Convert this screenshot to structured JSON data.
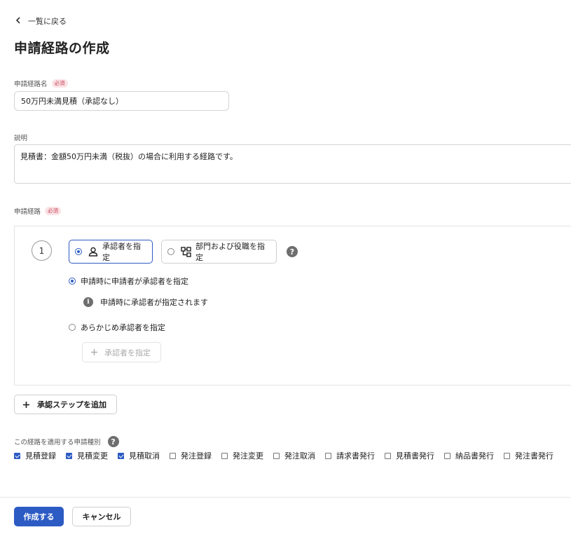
{
  "back_link": {
    "label": "一覧に戻る",
    "icon": "chevron-left-icon"
  },
  "page_title": "申請経路の作成",
  "route_name": {
    "label": "申請経路名",
    "required_badge": "必須",
    "value": "50万円未満見積（承認なし）"
  },
  "description": {
    "label": "説明",
    "value": "見積書：金額50万円未満（税抜）の場合に利用する経路です。"
  },
  "route": {
    "label": "申請経路",
    "required_badge": "必須",
    "steps": [
      {
        "number": "1",
        "options": [
          {
            "label": "承認者を指定",
            "icon": "person-icon",
            "selected": true
          },
          {
            "label": "部門および役職を指定",
            "icon": "org-chart-icon",
            "selected": false
          }
        ],
        "help_icon": "question-icon",
        "approver_modes": [
          {
            "label": "申請時に申請者が承認者を指定",
            "selected": true
          },
          {
            "label": "あらかじめ承認者を指定",
            "selected": false
          }
        ],
        "info_text": "申請時に承認者が指定されます",
        "specify_approver_button": "承認者を指定"
      }
    ],
    "add_step_button": "承認ステップを追加"
  },
  "application_types": {
    "label": "この経路を適用する申請種別",
    "help_icon": "question-icon",
    "items": [
      {
        "label": "見積登録",
        "checked": true
      },
      {
        "label": "見積変更",
        "checked": true
      },
      {
        "label": "見積取消",
        "checked": true
      },
      {
        "label": "発注登録",
        "checked": false
      },
      {
        "label": "発注変更",
        "checked": false
      },
      {
        "label": "発注取消",
        "checked": false
      },
      {
        "label": "請求書発行",
        "checked": false
      },
      {
        "label": "見積書発行",
        "checked": false
      },
      {
        "label": "納品書発行",
        "checked": false
      },
      {
        "label": "発注書発行",
        "checked": false
      }
    ]
  },
  "footer": {
    "create_button": "作成する",
    "cancel_button": "キャンセル"
  },
  "colors": {
    "primary": "#2d5bc4",
    "required_text": "#c84b5c",
    "required_bg": "#fbe3e6",
    "border": "#d4d4d4"
  }
}
